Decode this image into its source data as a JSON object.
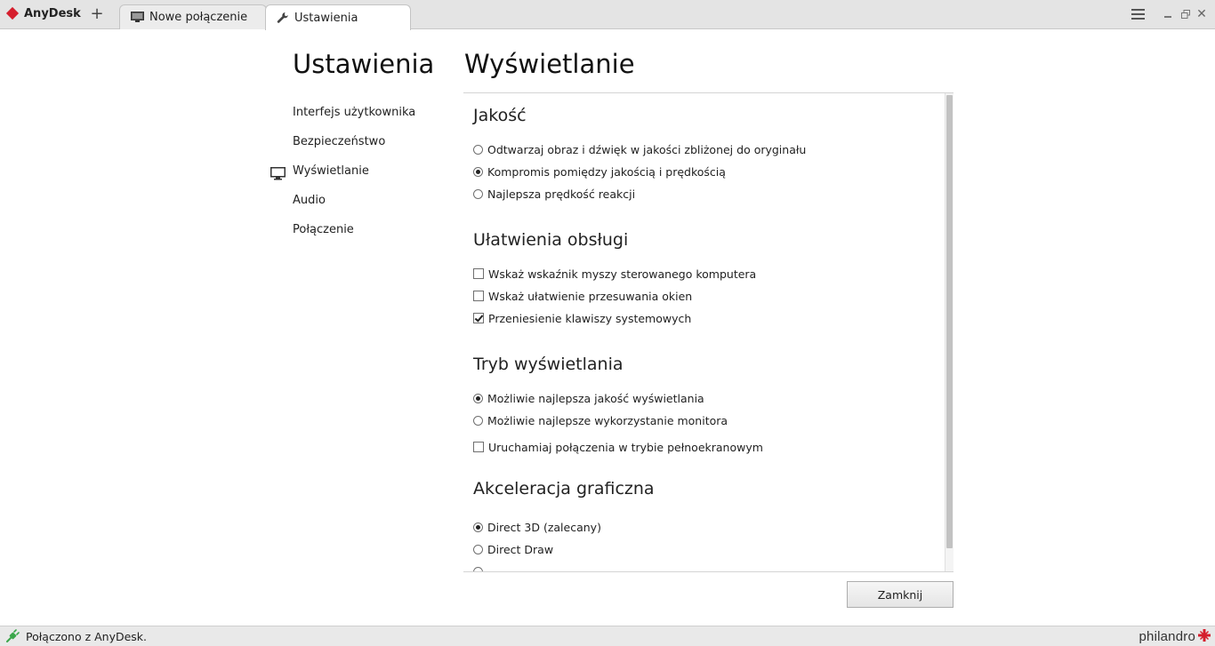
{
  "app": {
    "name": "AnyDesk",
    "brand_color": "#d51e2d",
    "new_tab_symbol": "+"
  },
  "tabs": [
    {
      "label": "Nowe połączenie",
      "icon": "monitor-icon",
      "active": false
    },
    {
      "label": "Ustawienia",
      "icon": "wrench-icon",
      "active": true
    }
  ],
  "window_controls": {
    "menu_icon": "hamburger-icon",
    "minimize_icon": "minimize-icon",
    "restore_icon": "restore-icon",
    "close_icon": "close-icon",
    "close_symbol": "✕"
  },
  "nav": {
    "title": "Ustawienia",
    "items": [
      {
        "label": "Interfejs użytkownika",
        "active": false
      },
      {
        "label": "Bezpieczeństwo",
        "active": false
      },
      {
        "label": "Wyświetlanie",
        "active": true,
        "icon": "monitor-icon"
      },
      {
        "label": "Audio",
        "active": false
      },
      {
        "label": "Połączenie",
        "active": false
      }
    ]
  },
  "page": {
    "title": "Wyświetlanie",
    "sections": [
      {
        "title": "Jakość",
        "options": [
          {
            "type": "radio",
            "label": "Odtwarzaj obraz i dźwięk w jakości zbliżonej do oryginału",
            "checked": false
          },
          {
            "type": "radio",
            "label": "Kompromis pomiędzy jakością i prędkością",
            "checked": true
          },
          {
            "type": "radio",
            "label": "Najlepsza prędkość reakcji",
            "checked": false
          }
        ]
      },
      {
        "title": "Ułatwienia obsługi",
        "options": [
          {
            "type": "checkbox",
            "label": "Wskaż wskaźnik myszy sterowanego komputera",
            "checked": false
          },
          {
            "type": "checkbox",
            "label": "Wskaż ułatwienie przesuwania okien",
            "checked": false
          },
          {
            "type": "checkbox",
            "label": "Przeniesienie klawiszy systemowych",
            "checked": true
          }
        ]
      },
      {
        "title": "Tryb wyświetlania",
        "options": [
          {
            "type": "radio",
            "label": "Możliwie najlepsza jakość wyświetlania",
            "checked": true
          },
          {
            "type": "radio",
            "label": "Możliwie najlepsze wykorzystanie monitora",
            "checked": false
          },
          {
            "type": "checkbox",
            "label": "Uruchamiaj połączenia w trybie pełnoekranowym",
            "checked": false
          }
        ]
      },
      {
        "title": "Akceleracja graficzna",
        "options": [
          {
            "type": "radio",
            "label": "Direct 3D (zalecany)",
            "checked": true
          },
          {
            "type": "radio",
            "label": "Direct Draw",
            "checked": false
          }
        ]
      }
    ]
  },
  "buttons": {
    "close_label": "Zamknij"
  },
  "status": {
    "text": "Połączono z AnyDesk.",
    "icon": "plug-connected-icon",
    "icon_color": "#3aa64a"
  },
  "vendor": {
    "name": "philandro",
    "logo_color": "#d51e2d"
  }
}
